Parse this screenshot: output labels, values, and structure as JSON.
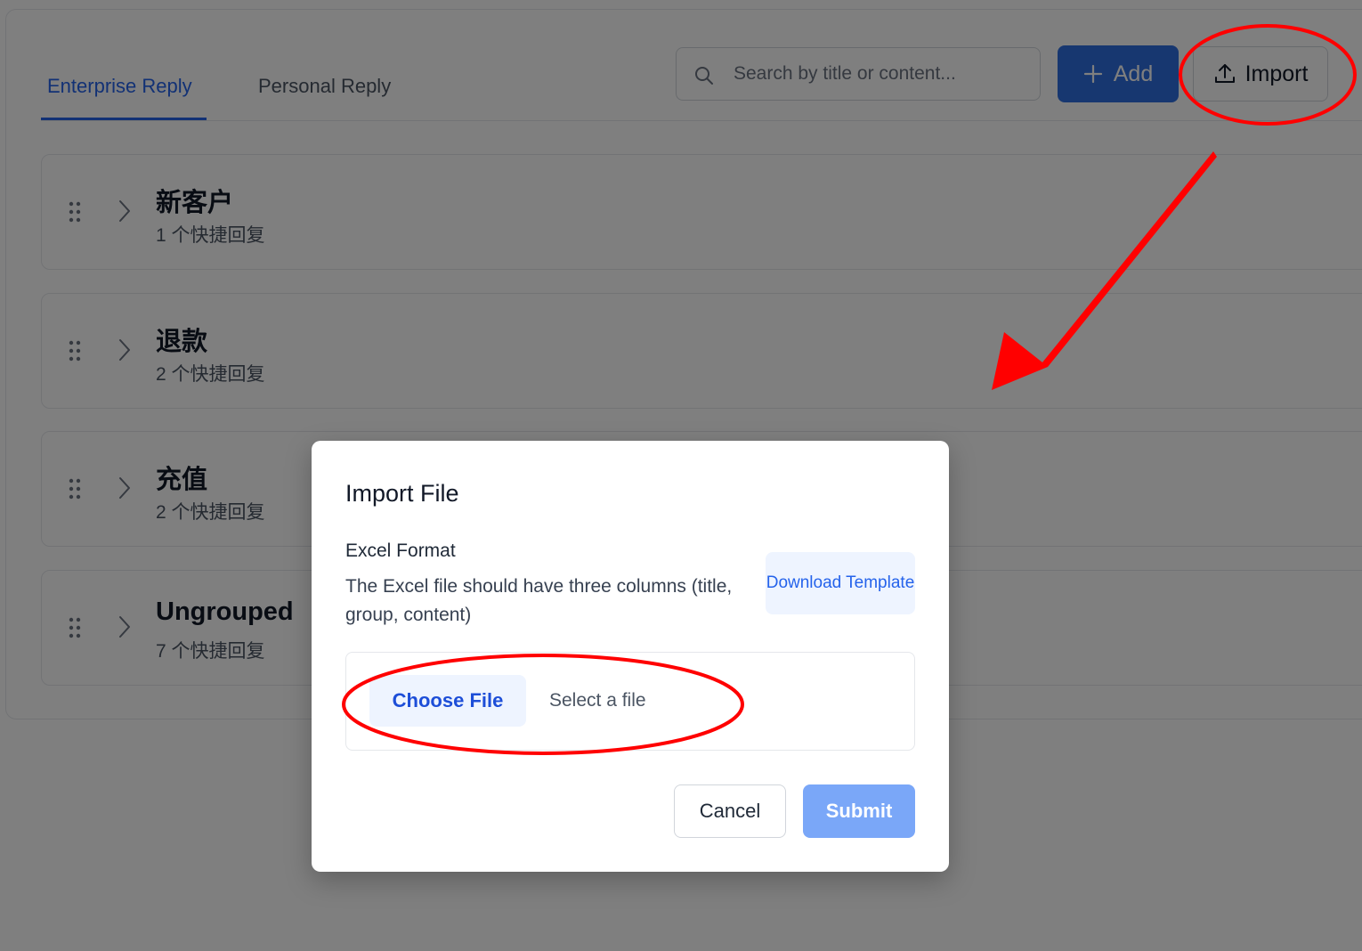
{
  "tabs": [
    {
      "label": "Enterprise Reply",
      "active": true
    },
    {
      "label": "Personal Reply",
      "active": false
    }
  ],
  "search": {
    "placeholder": "Search by title or content..."
  },
  "toolbar": {
    "add_label": "Add",
    "import_label": "Import"
  },
  "groups": [
    {
      "name": "新客户",
      "count": "1 个快捷回复"
    },
    {
      "name": "退款",
      "count": "2 个快捷回复"
    },
    {
      "name": "充值",
      "count": "2 个快捷回复"
    },
    {
      "name": "Ungrouped",
      "count": "7 个快捷回复"
    }
  ],
  "modal": {
    "title": "Import File",
    "format_title": "Excel Format",
    "format_desc": "The Excel file should have three columns (title, group, content)",
    "download_label": "Download Template",
    "choose_label": "Choose File",
    "file_status": "Select a file",
    "cancel_label": "Cancel",
    "submit_label": "Submit"
  },
  "colors": {
    "accent": "#2563eb",
    "annotation": "#ff0000",
    "submit_disabled": "#7aa7f8"
  },
  "icons": [
    "search-icon",
    "plus-icon",
    "upload-icon",
    "drag-handle-icon",
    "chevron-right-icon"
  ]
}
